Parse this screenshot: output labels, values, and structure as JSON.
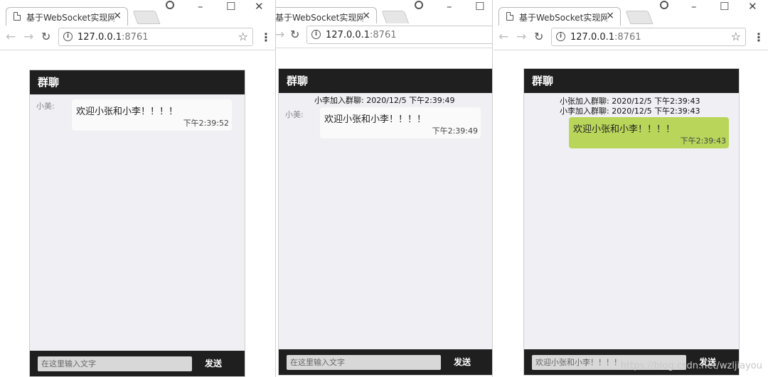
{
  "windows": [
    {
      "tab_title": "基于WebSocket实现网",
      "address_host": "127.0.0.1",
      "address_port": ":8761",
      "chat_title": "群聊",
      "system_messages": [],
      "message": {
        "sender": "小美:",
        "text": "欢迎小张和小李！！！！",
        "time": "下午2:39:52",
        "mine": false
      },
      "input_value": "在这里输入文字",
      "send_label": "发送"
    },
    {
      "tab_title": "基于WebSocket实现网",
      "address_host": "127.0.0.1",
      "address_port": ":8761",
      "chat_title": "群聊",
      "system_messages": [
        "小李加入群聊: 2020/12/5 下午2:39:49"
      ],
      "message": {
        "sender": "小美:",
        "text": "欢迎小张和小李！！！！",
        "time": "下午2:39:49",
        "mine": false
      },
      "input_value": "在这里输入文字",
      "send_label": "发送"
    },
    {
      "tab_title": "基于WebSocket实现网",
      "address_host": "127.0.0.1",
      "address_port": ":8761",
      "chat_title": "群聊",
      "system_messages": [
        "小张加入群聊: 2020/12/5 下午2:39:43",
        "小李加入群聊: 2020/12/5 下午2:39:43"
      ],
      "message": {
        "sender": "",
        "text": "欢迎小张和小李！！！！",
        "time": "下午2:39:43",
        "mine": true
      },
      "input_value": "欢迎小张和小李！！！！",
      "send_label": "发送"
    }
  ],
  "icons": {
    "page": "document-icon",
    "close": "close-icon",
    "back": "back-arrow-icon",
    "forward": "forward-arrow-icon",
    "reload": "reload-icon",
    "info": "info-icon",
    "star": "bookmark-star-icon",
    "menu": "kebab-menu-icon",
    "account": "account-icon"
  },
  "colors": {
    "chat_header": "#1f1f1f",
    "chat_body": "#efeff4",
    "my_bubble": "#b9d65a",
    "other_bubble": "#fafafa"
  },
  "watermark": "https://blog.csdn.net/wzljiayou"
}
